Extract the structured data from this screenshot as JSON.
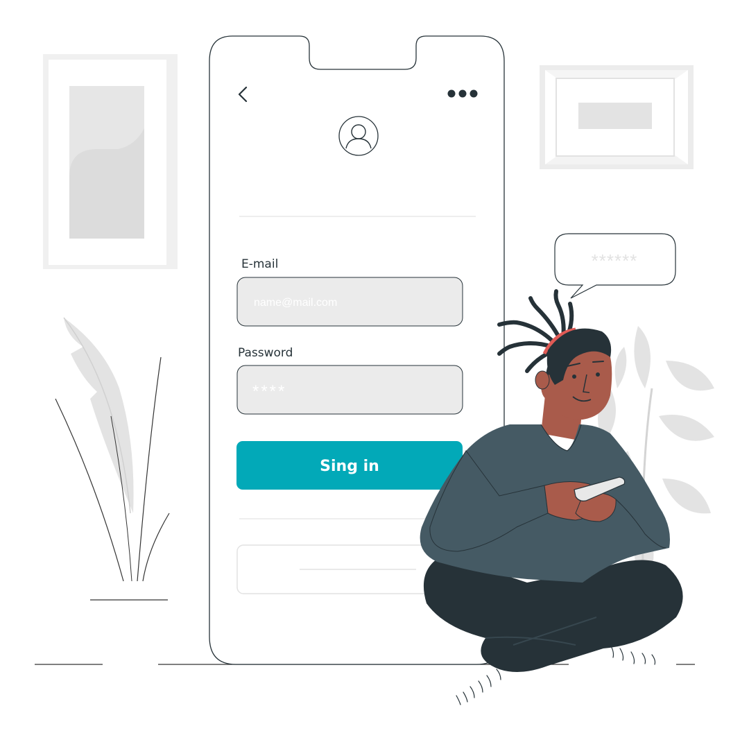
{
  "phone": {
    "back_icon": "chevron-left-icon",
    "menu_icon": "more-horizontal-icon",
    "avatar_icon": "user-icon",
    "email_label": "E-mail",
    "email_placeholder": "name@mail.com",
    "password_label": "Password",
    "password_value": "****",
    "signin_label": "Sing in"
  },
  "speech_bubble": {
    "text": "******"
  },
  "colors": {
    "accent": "#02A9B8",
    "shirt": "#455A64",
    "pants": "#263238",
    "skin": "#A95B4B",
    "hair": "#263238",
    "headband": "#E05A55",
    "field_bg": "#EBEBEB",
    "decor_gray": "#E0E0E0"
  }
}
